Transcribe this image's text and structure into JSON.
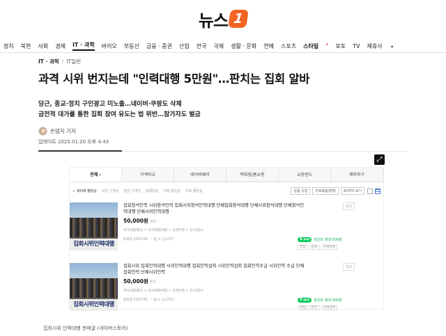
{
  "logo": {
    "text": "뉴스",
    "mark": "1"
  },
  "nav": [
    "정치",
    "북한",
    "사회",
    "경제",
    "IT · 과학",
    "바이오",
    "부동산",
    "금융 · 증권",
    "산업",
    "전국",
    "국제",
    "생활 · 문화",
    "연예",
    "스포츠",
    "스타일",
    "포토",
    "TV",
    "제휴사"
  ],
  "nav_active": "IT · 과학",
  "breadcrumb": {
    "section": "IT · 과학",
    "sub": "IT일반"
  },
  "headline": "과격 시위 번지는데 \"인력대행 5만원\"…판치는 집회 알바",
  "subheads": [
    "당근, 종교·정치 구인광고 미노출…네이버·쿠팡도 삭제",
    "금전적 대가를 통한 집회 참여 유도는 법 위반…참가자도 벌금"
  ],
  "author": "손엄지 기자",
  "updated": "업데이트 2025.01.20 오후 4:43",
  "expand_icon": "⤢",
  "shop": {
    "tabs": [
      "전체",
      "가격비교",
      "네이버페이",
      "백화점/홈쇼핑",
      "쇼핑윈도",
      "해외직구"
    ],
    "filters": [
      "✓ 네이버 랭킹순",
      "낮은 가격순",
      "높은 가격순",
      "등록일순",
      "리뷰 많은순",
      "리뷰 좋은순"
    ],
    "selects": [
      "상품 유형",
      "무료배송/판매",
      "40개씩 보기"
    ],
    "items": [
      {
        "thumb_caption": "집회시위인력대행",
        "title": "집회참석인력 시위참석인력 집회시위참석인력대행 단체집회참석대행 단체시위참석대행 단체참석인력대행 단체시위인력대행",
        "price": "50,000원",
        "price_note": "최저",
        "meta": "여가/생활편의 > 국내여행/체험 > 공연티켓 > 전시/행사",
        "meta2": "등록일 2023.06.  ♡ 찜  ⚠ 신고하기",
        "tag": "정보",
        "npay": "포인트 최대 500원",
        "acts": [
          "적립",
          "문의",
          "구매정보"
        ]
      },
      {
        "thumb_caption": "집회시위인력대행",
        "title": "집회시위 집회인력대행 시위인력대행 집회인력섭외 시위인력섭외 집회인력수급 시위인력 수급 단체집회인력 단체시위인력",
        "price": "50,000원",
        "price_note": "최저",
        "meta": "여가/생활편의 > 국내여행/체험 > 공연티켓 > 전시/행사",
        "meta2": "등록일 2023.06.  ♡ 찜  ⚠ 신고하기",
        "tag": "정보",
        "npay": "포인트 최대 500원",
        "acts": [
          "적립",
          "문의",
          "구매정보"
        ]
      }
    ]
  },
  "caption": "집회시위 인력대행 판매글 (네이버스토어)"
}
